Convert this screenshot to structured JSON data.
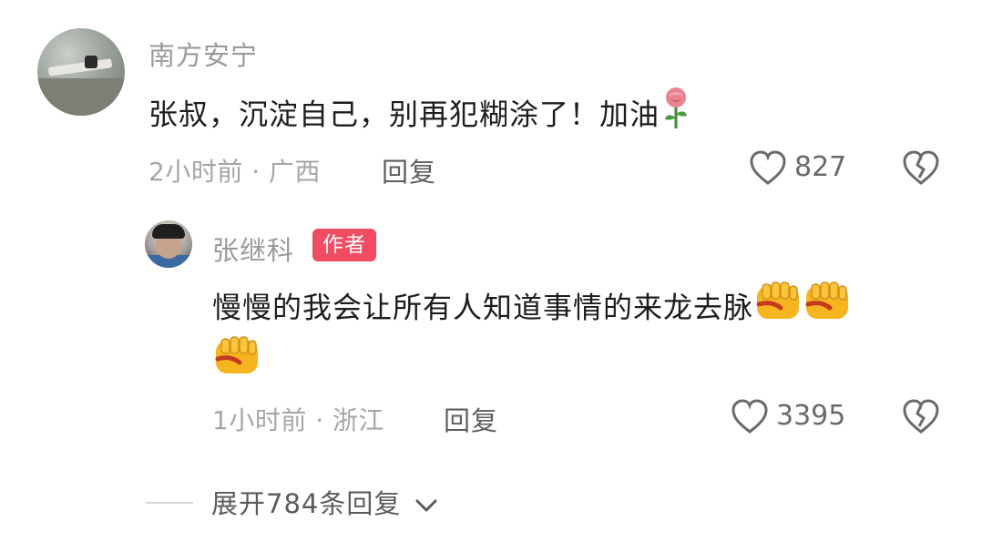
{
  "comments": [
    {
      "username": "南方安宁",
      "text": "张叔，沉淀自己，别再犯糊涂了！加油",
      "emoji": "rose-icon",
      "time_location": "2小时前 · 广西",
      "reply_label": "回复",
      "like_count": "827"
    }
  ],
  "reply": {
    "username": "张继科",
    "badge": "作者",
    "text_line1": "慢慢的我会让所有人知道事情的来龙去脉",
    "emojis": [
      "fist-icon",
      "fist-icon",
      "fist-icon"
    ],
    "time_location": "1小时前 · 浙江",
    "reply_label": "回复",
    "like_count": "3395"
  },
  "expand_label": "展开784条回复",
  "colors": {
    "badge": "#f24b62",
    "text": "#1d1d1d",
    "meta": "#a6a6a6"
  }
}
